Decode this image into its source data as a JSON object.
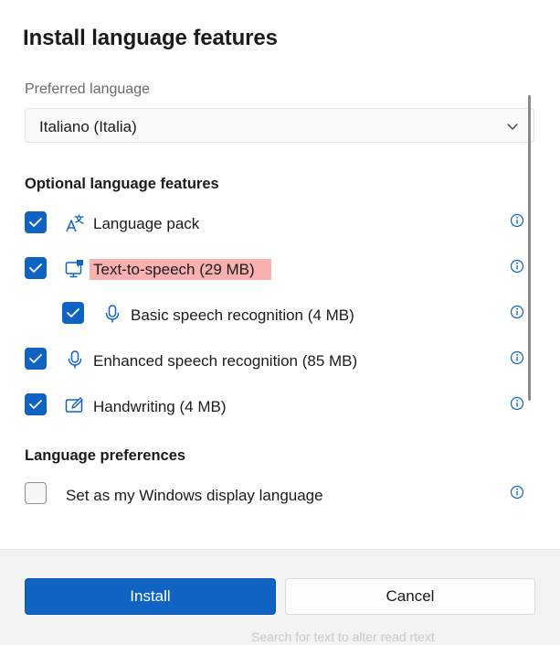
{
  "dialog": {
    "title": "Install language features",
    "preferred_language_label": "Preferred language",
    "preferred_language_value": "Italiano (Italia)",
    "optional_features_heading": "Optional language features",
    "features": [
      {
        "label": "Language pack",
        "checked": true,
        "icon": "language-pack-icon"
      },
      {
        "label": "Text-to-speech (29 MB)",
        "checked": true,
        "icon": "text-to-speech-icon",
        "highlighted": true
      },
      {
        "label": "Basic speech recognition (4 MB)",
        "checked": true,
        "icon": "microphone-icon",
        "indented": true
      },
      {
        "label": "Enhanced speech recognition (85 MB)",
        "checked": true,
        "icon": "microphone-icon"
      },
      {
        "label": "Handwriting (4 MB)",
        "checked": true,
        "icon": "pen-icon"
      }
    ],
    "preferences_heading": "Language preferences",
    "preferences": [
      {
        "label": "Set as my Windows display language",
        "checked": false
      }
    ],
    "install_label": "Install",
    "cancel_label": "Cancel",
    "background_text": "Search for text to alter read rtext"
  },
  "colors": {
    "accent": "#0f63c2",
    "highlight": "#f8b0b0"
  }
}
